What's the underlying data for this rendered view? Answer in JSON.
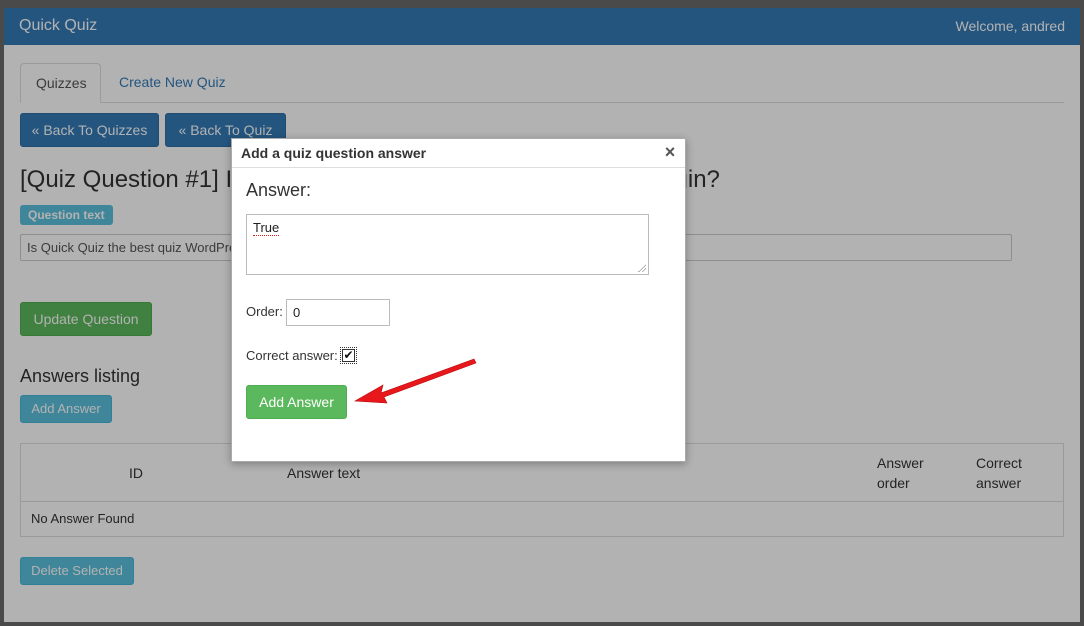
{
  "navbar": {
    "brand": "Quick Quiz",
    "welcome": "Welcome, andred"
  },
  "tabs": [
    {
      "label": "Quizzes",
      "active": true
    },
    {
      "label": "Create New Quiz",
      "active": false
    }
  ],
  "buttons": {
    "back_to_quizzes": "« Back To Quizzes",
    "back_to_quiz": "« Back To Quiz",
    "update_question": "Update Question",
    "add_answer": "Add Answer",
    "delete_selected": "Delete Selected"
  },
  "question": {
    "title": "[Quiz Question #1] Is Quick Quiz the best quiz WordPress plugin?",
    "badge": "Question text",
    "text": "Is Quick Quiz the best quiz WordPress plugin?"
  },
  "answers": {
    "heading": "Answers listing",
    "columns": [
      "ID",
      "Answer text",
      "Answer order",
      "Correct answer"
    ],
    "empty": "No Answer Found"
  },
  "dialog": {
    "title": "Add a quiz question answer",
    "close": "×",
    "heading": "Answer:",
    "answer_value": "True",
    "order_label": "Order:",
    "order_value": "0",
    "correct_label": "Correct answer:",
    "correct_checked": "✔",
    "submit": "Add Answer"
  },
  "colors": {
    "primary": "#337ab7",
    "info": "#5bc0de",
    "success": "#5cb85c",
    "arrow": "#e8171b"
  }
}
